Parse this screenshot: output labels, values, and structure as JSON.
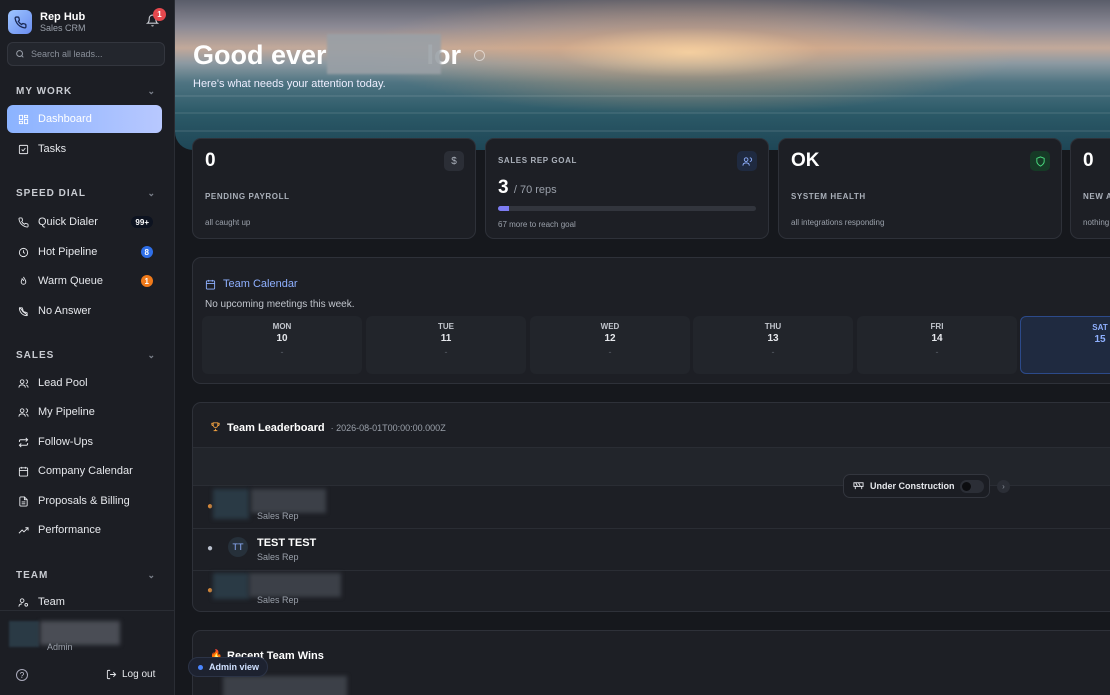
{
  "brand": {
    "title": "Rep Hub",
    "subtitle": "Sales CRM",
    "notif_count": "1"
  },
  "search": {
    "placeholder": "Search all leads..."
  },
  "sections": {
    "my_work": "MY WORK",
    "speed_dial": "SPEED DIAL",
    "sales": "SALES",
    "team": "TEAM"
  },
  "nav": {
    "dashboard": "Dashboard",
    "tasks": "Tasks",
    "quick_dialer": "Quick Dialer",
    "quick_dialer_badge": "99+",
    "hot_pipeline": "Hot Pipeline",
    "hot_pipeline_badge": "8",
    "warm_queue": "Warm Queue",
    "warm_queue_badge": "1",
    "no_answer": "No Answer",
    "lead_pool": "Lead Pool",
    "my_pipeline": "My Pipeline",
    "follow_ups": "Follow-Ups",
    "company_calendar": "Company Calendar",
    "proposals_billing": "Proposals & Billing",
    "performance": "Performance",
    "team": "Team"
  },
  "footer": {
    "role": "Admin",
    "help": "?",
    "logout": "Log out"
  },
  "hero": {
    "title_start": "Good ever",
    "title_end": "lor",
    "subtitle": "Here's what needs your attention today."
  },
  "stats": [
    {
      "value": "0",
      "label": "PENDING PAYROLL",
      "sub": "all caught up"
    },
    {
      "value": "3",
      "unit": "/ 70 reps",
      "label": "SALES REP GOAL",
      "sub": "67 more to reach goal",
      "progress": 0.043
    },
    {
      "value": "OK",
      "label": "SYSTEM HEALTH",
      "sub": "all integrations responding"
    },
    {
      "value": "0",
      "label": "NEW AI",
      "sub": "nothing"
    }
  ],
  "calendar": {
    "title": "Team Calendar",
    "note": "No upcoming meetings this week.",
    "days": [
      {
        "name": "MON",
        "date": "10",
        "dot": "-"
      },
      {
        "name": "TUE",
        "date": "11",
        "dot": "-"
      },
      {
        "name": "WED",
        "date": "12",
        "dot": "-"
      },
      {
        "name": "THU",
        "date": "13",
        "dot": "-"
      },
      {
        "name": "FRI",
        "date": "14",
        "dot": "-"
      },
      {
        "name": "SAT",
        "date": "15",
        "dot": ""
      }
    ]
  },
  "leaderboard": {
    "title": "Team Leaderboard",
    "meta": "· 2026-08-01T00:00:00.000Z",
    "rows": [
      {
        "initials": "",
        "name": "",
        "role": "Sales Rep"
      },
      {
        "initials": "TT",
        "name": "TEST TEST",
        "role": "Sales Rep"
      },
      {
        "initials": "",
        "name": "",
        "role": "Sales Rep"
      }
    ]
  },
  "under_construction": {
    "label": "Under Construction",
    "arrow": "›"
  },
  "wins": {
    "title": "Recent Team Wins"
  },
  "admin_view": "Admin view",
  "colors": {
    "accent": "#8bb3ff",
    "badge_blue": "#2f6fe8",
    "badge_orange": "#f07a1a",
    "notif_red": "#e5484d"
  }
}
